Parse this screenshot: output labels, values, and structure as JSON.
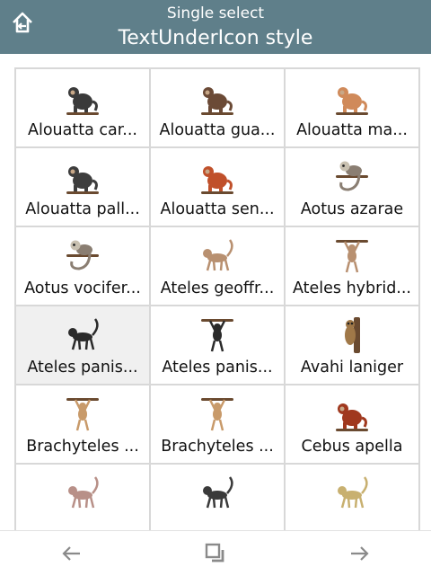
{
  "header": {
    "mode": "Single select",
    "style": "TextUnderIcon style",
    "home_icon": "home-back-icon"
  },
  "colors": {
    "header_bg": "#5f7f8a",
    "grid_line": "#d8d8d8",
    "selected_bg": "#f0f0f0",
    "footer_icon": "#8a8a8a"
  },
  "grid": {
    "items": [
      {
        "label": "Alouatta car...",
        "icon": "dark-monkey-sitting-icon",
        "color": "#3a3a3a",
        "pose": "sit"
      },
      {
        "label": "Alouatta gua...",
        "icon": "brown-monkey-sitting-icon",
        "color": "#6b4a36",
        "pose": "sit"
      },
      {
        "label": "Alouatta ma...",
        "icon": "tan-monkey-sitting-icon",
        "color": "#d08a5a",
        "pose": "sit"
      },
      {
        "label": "Alouatta pall...",
        "icon": "dark-monkey-sitting-icon",
        "color": "#3d3d3d",
        "pose": "sit"
      },
      {
        "label": "Alouatta sen...",
        "icon": "red-monkey-sitting-icon",
        "color": "#c0502a",
        "pose": "sit"
      },
      {
        "label": "Aotus azarae",
        "icon": "grey-monkey-branch-icon",
        "color": "#8a7e72",
        "pose": "branch"
      },
      {
        "label": "Aotus vocifer...",
        "icon": "grey-monkey-branch-icon",
        "color": "#8a7e72",
        "pose": "branch"
      },
      {
        "label": "Ateles geoffr...",
        "icon": "tan-monkey-walking-icon",
        "color": "#b89070",
        "pose": "walk"
      },
      {
        "label": "Ateles hybrid...",
        "icon": "tan-monkey-hanging-icon",
        "color": "#b89070",
        "pose": "hang"
      },
      {
        "label": "Ateles panis...",
        "icon": "black-monkey-climbing-icon",
        "color": "#2a2a2a",
        "pose": "walk",
        "selected": true
      },
      {
        "label": "Ateles panis...",
        "icon": "black-monkey-hanging-icon",
        "color": "#2a2a2a",
        "pose": "hang"
      },
      {
        "label": "Avahi laniger",
        "icon": "lemur-on-trunk-icon",
        "color": "#a07848",
        "pose": "trunk"
      },
      {
        "label": "Brachyteles ...",
        "icon": "tan-monkey-hanging-icon",
        "color": "#c89a6a",
        "pose": "hang"
      },
      {
        "label": "Brachyteles ...",
        "icon": "tan-monkey-hanging-icon",
        "color": "#c89a6a",
        "pose": "hang"
      },
      {
        "label": "Cebus apella",
        "icon": "capuchin-sitting-icon",
        "color": "#a0381e",
        "pose": "sit"
      },
      {
        "label": "",
        "icon": "grey-monkey-walking-icon",
        "color": "#b89088",
        "pose": "walk"
      },
      {
        "label": "",
        "icon": "black-monkey-walking-icon",
        "color": "#3a3a3a",
        "pose": "walk"
      },
      {
        "label": "",
        "icon": "yellow-monkey-walking-icon",
        "color": "#c8b070",
        "pose": "walk"
      }
    ]
  },
  "footer": {
    "prev_icon": "arrow-left-icon",
    "center_icon": "copy-icon",
    "next_icon": "arrow-right-icon"
  }
}
